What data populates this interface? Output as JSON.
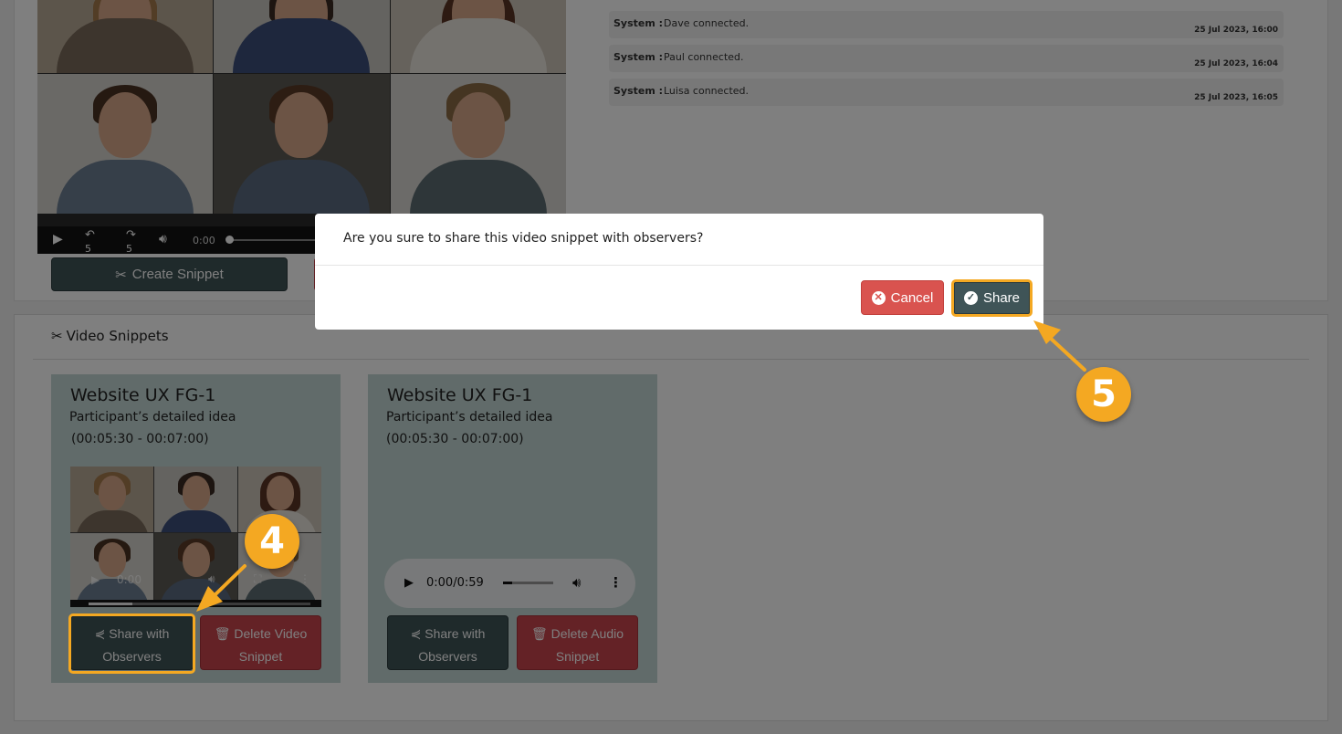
{
  "player": {
    "skip_back": "5",
    "skip_fwd": "5",
    "time": "0:00"
  },
  "create_snippet_label": "Create Snippet",
  "chat_log": [
    {
      "who": "System :",
      "msg": "Dave connected.",
      "ts": "25 Jul 2023, 16:00"
    },
    {
      "who": "System :",
      "msg": "Paul connected.",
      "ts": "25 Jul 2023, 16:04"
    },
    {
      "who": "System :",
      "msg": "Luisa connected.",
      "ts": "25 Jul 2023, 16:05"
    }
  ],
  "snippets_heading": "Video Snippets",
  "cards": [
    {
      "title": "Website UX FG-1",
      "subtitle": "Participant’s detailed idea",
      "range": "(00:05:30 - 00:07:00)",
      "share_line1": "Share with",
      "share_line2": "Observers",
      "delete_line1": "Delete Video",
      "delete_line2": "Snippet",
      "overlay_time": "0:00"
    },
    {
      "title": "Website UX FG-1",
      "subtitle": "Participant’s detailed idea",
      "range": "(00:05:30 - 00:07:00)",
      "audio_time": "0:00/0:59",
      "share_line1": "Share with",
      "share_line2": "Observers",
      "delete_line1": "Delete Audio",
      "delete_line2": "Snippet"
    }
  ],
  "modal": {
    "question": "Are you sure to share this video snippet with observers?",
    "cancel_label": "Cancel",
    "share_label": "Share"
  },
  "annotations": {
    "step_4": "4",
    "step_5": "5",
    "highlight_color": "#f4a822"
  },
  "colors": {
    "dark_button": "#3f5457",
    "danger_button": "#c9444d",
    "card_bg": "#c3d7d4"
  },
  "icons": [
    "scissors-icon",
    "share-icon",
    "trash-icon",
    "times-circle-icon",
    "check-circle-icon",
    "play-icon",
    "volume-icon",
    "more-vert-icon",
    "fullscreen-icon"
  ]
}
